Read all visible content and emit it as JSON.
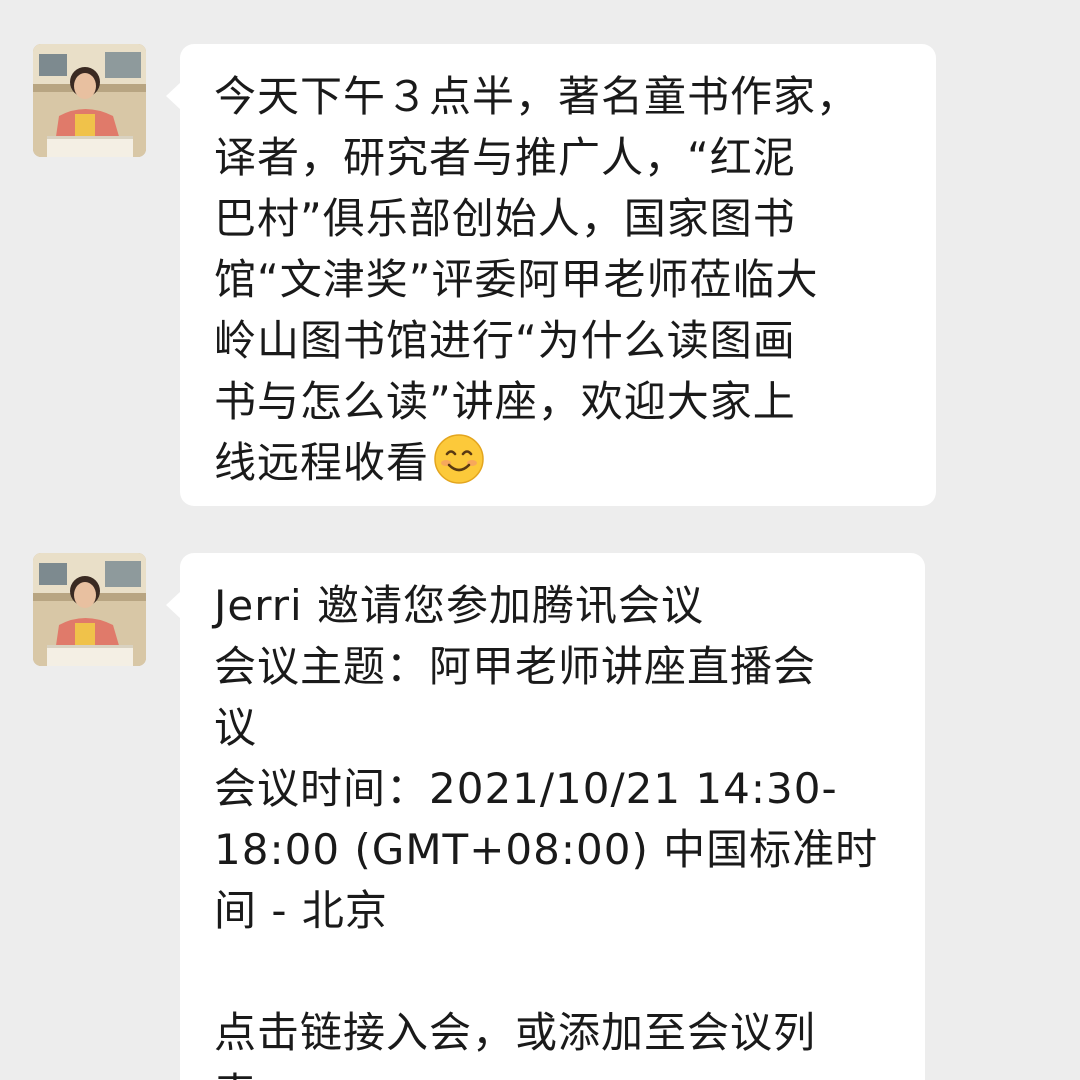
{
  "messages": [
    {
      "lines": [
        "今天下午３点半，著名童书作家，",
        "译者，研究者与推广人，“红泥",
        "巴村”俱乐部创始人，国家图书",
        "馆“文津奖”评委阿甲老师莅临大",
        "岭山图书馆进行“为什么读图画",
        "书与怎么读”讲座，欢迎大家上",
        "线远程收看"
      ],
      "emoji": "smiling-face-emoji"
    },
    {
      "lines": [
        "Jerri 邀请您参加腾讯会议",
        "会议主题：阿甲老师讲座直播会",
        "议",
        "会议时间：2021/10/21 14:30-",
        "18:00 (GMT+08:00) 中国标准时",
        "间 - 北京",
        "",
        "点击链接入会，或添加至会议列",
        "表："
      ]
    }
  ],
  "colors": {
    "background": "#ededed",
    "bubble": "#ffffff",
    "text": "#1a1a1a"
  }
}
